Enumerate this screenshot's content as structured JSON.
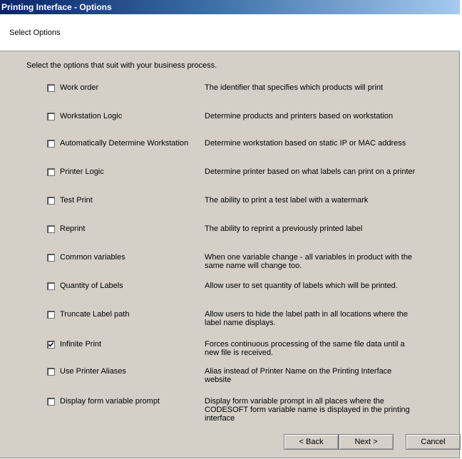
{
  "window": {
    "title": "Printing Interface - Options"
  },
  "header": {
    "title": "Select Options"
  },
  "intro": "Select the options that suit with your business process.",
  "options": [
    {
      "label": "Work order",
      "description": "The identifier that specifies which products will print",
      "checked": false
    },
    {
      "label": "Workstation Logic",
      "description": "Determine products and printers based on workstation",
      "checked": false
    },
    {
      "label": "Automatically Determine Workstation",
      "description": "Determine workstation based on static IP or MAC address",
      "checked": false
    },
    {
      "label": "Printer Logic",
      "description": "Determine printer based on what labels can print on a printer",
      "checked": false
    },
    {
      "label": "Test Print",
      "description": "The ability to print a test label with a watermark",
      "checked": false
    },
    {
      "label": "Reprint",
      "description": "The ability to reprint a previously printed label",
      "checked": false
    },
    {
      "label": "Common variables",
      "description": "When one variable change - all variables in product with the same name will change too.",
      "checked": false
    },
    {
      "label": "Quantity of Labels",
      "description": "Allow user to set quantity of labels which will be printed.",
      "checked": false
    },
    {
      "label": "Truncate Label path",
      "description": "Allow users to hide the label path in all locations where the label name displays.",
      "checked": false
    },
    {
      "label": "Infinite Print",
      "description": "Forces continuous processing of the same file data until a new file is received.",
      "checked": true
    },
    {
      "label": "Use Printer Aliases",
      "description": " Alias instead of Printer Name on the Printing Interface website",
      "checked": false
    },
    {
      "label": "Display form variable prompt",
      "description": "Display form variable prompt in all places where the CODESOFT form variable name is displayed in the printing interface",
      "checked": false
    }
  ],
  "buttons": {
    "back": "< Back",
    "next": "Next >",
    "cancel": "Cancel"
  }
}
